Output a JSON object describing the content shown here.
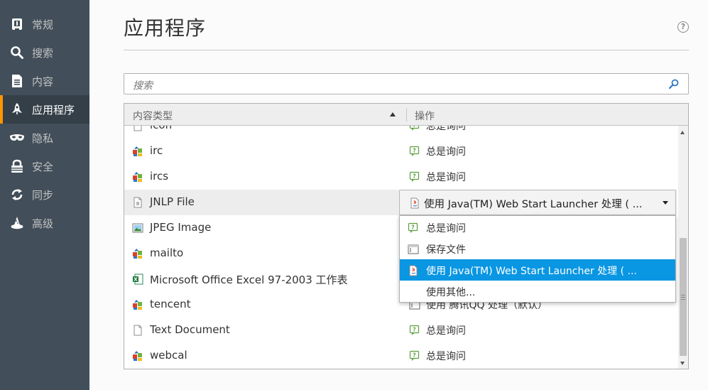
{
  "sidebar": {
    "items": [
      {
        "label": "常规",
        "icon": "general-icon",
        "active": false
      },
      {
        "label": "搜索",
        "icon": "search-icon",
        "active": false
      },
      {
        "label": "内容",
        "icon": "content-icon",
        "active": false
      },
      {
        "label": "应用程序",
        "icon": "rocket-icon",
        "active": true
      },
      {
        "label": "隐私",
        "icon": "mask-icon",
        "active": false
      },
      {
        "label": "安全",
        "icon": "lock-icon",
        "active": false
      },
      {
        "label": "同步",
        "icon": "sync-icon",
        "active": false
      },
      {
        "label": "高级",
        "icon": "wizard-hat-icon",
        "active": false
      }
    ]
  },
  "header": {
    "title": "应用程序",
    "help_glyph": "?"
  },
  "search": {
    "placeholder": "搜索"
  },
  "table": {
    "columns": {
      "content_type": "内容类型",
      "action": "操作"
    },
    "rows": [
      {
        "name": "icon",
        "icon": "blank-file-icon",
        "action": "总是询问",
        "action_icon": "ask-icon"
      },
      {
        "name": "irc",
        "icon": "app-icon",
        "action": "总是询问",
        "action_icon": "ask-icon"
      },
      {
        "name": "ircs",
        "icon": "app-icon",
        "action": "总是询问",
        "action_icon": "ask-icon"
      },
      {
        "name": "JNLP File",
        "icon": "jnlp-file-icon",
        "action": "",
        "action_icon": ""
      },
      {
        "name": "JPEG Image",
        "icon": "image-file-icon",
        "action": "",
        "action_icon": ""
      },
      {
        "name": "mailto",
        "icon": "app-icon",
        "action": "",
        "action_icon": ""
      },
      {
        "name": "Microsoft Office Excel 97-2003 工作表",
        "icon": "excel-file-icon",
        "action": "",
        "action_icon": ""
      },
      {
        "name": "tencent",
        "icon": "app-icon",
        "action": "使用 腾讯QQ 处理（默认）",
        "action_icon": "window-icon"
      },
      {
        "name": "Text Document",
        "icon": "text-file-icon",
        "action": "总是询问",
        "action_icon": "ask-icon"
      },
      {
        "name": "webcal",
        "icon": "app-icon",
        "action": "总是询问",
        "action_icon": "ask-icon"
      }
    ]
  },
  "dropdown": {
    "selected": "使用 Java(TM) Web Start Launcher 处理 ( ...",
    "options": [
      {
        "label": "总是询问",
        "icon": "ask-icon",
        "highlighted": false
      },
      {
        "label": "保存文件",
        "icon": "save-file-icon",
        "highlighted": false
      },
      {
        "label": "使用 Java(TM) Web Start Launcher 处理 ( ...",
        "icon": "java-icon",
        "highlighted": true
      },
      {
        "label": "使用其他...",
        "icon": "",
        "highlighted": false
      }
    ]
  },
  "colors": {
    "sidebar_bg": "#424f5a",
    "sidebar_active_bg": "#343f48",
    "accent": "#ff9500",
    "highlight": "#0996e3"
  }
}
